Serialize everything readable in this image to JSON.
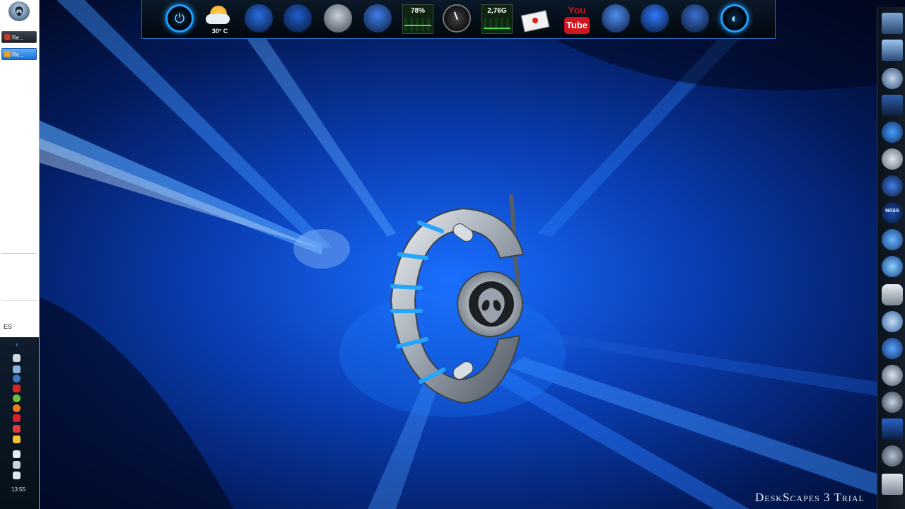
{
  "taskbar": {
    "tasks": [
      {
        "label": "Re...",
        "state": "normal"
      },
      {
        "label": "Re...",
        "state": "active"
      }
    ],
    "language": "ES",
    "clock": "13:55"
  },
  "top_dock": {
    "weather_temp": "30° C",
    "cpu_value": "78%",
    "memory_value": "2,76G",
    "youtube_top": "You",
    "youtube_bottom": "Tube"
  },
  "right_dock": {
    "nasa_label": "NASA"
  },
  "watermark": "DeskScapes 3 Trial",
  "colors": {
    "accent": "#1ea0ff",
    "taskbar_bg": "#ffffff",
    "dock_bg": "#02070d",
    "wallpaper": "#0a3fa8"
  }
}
